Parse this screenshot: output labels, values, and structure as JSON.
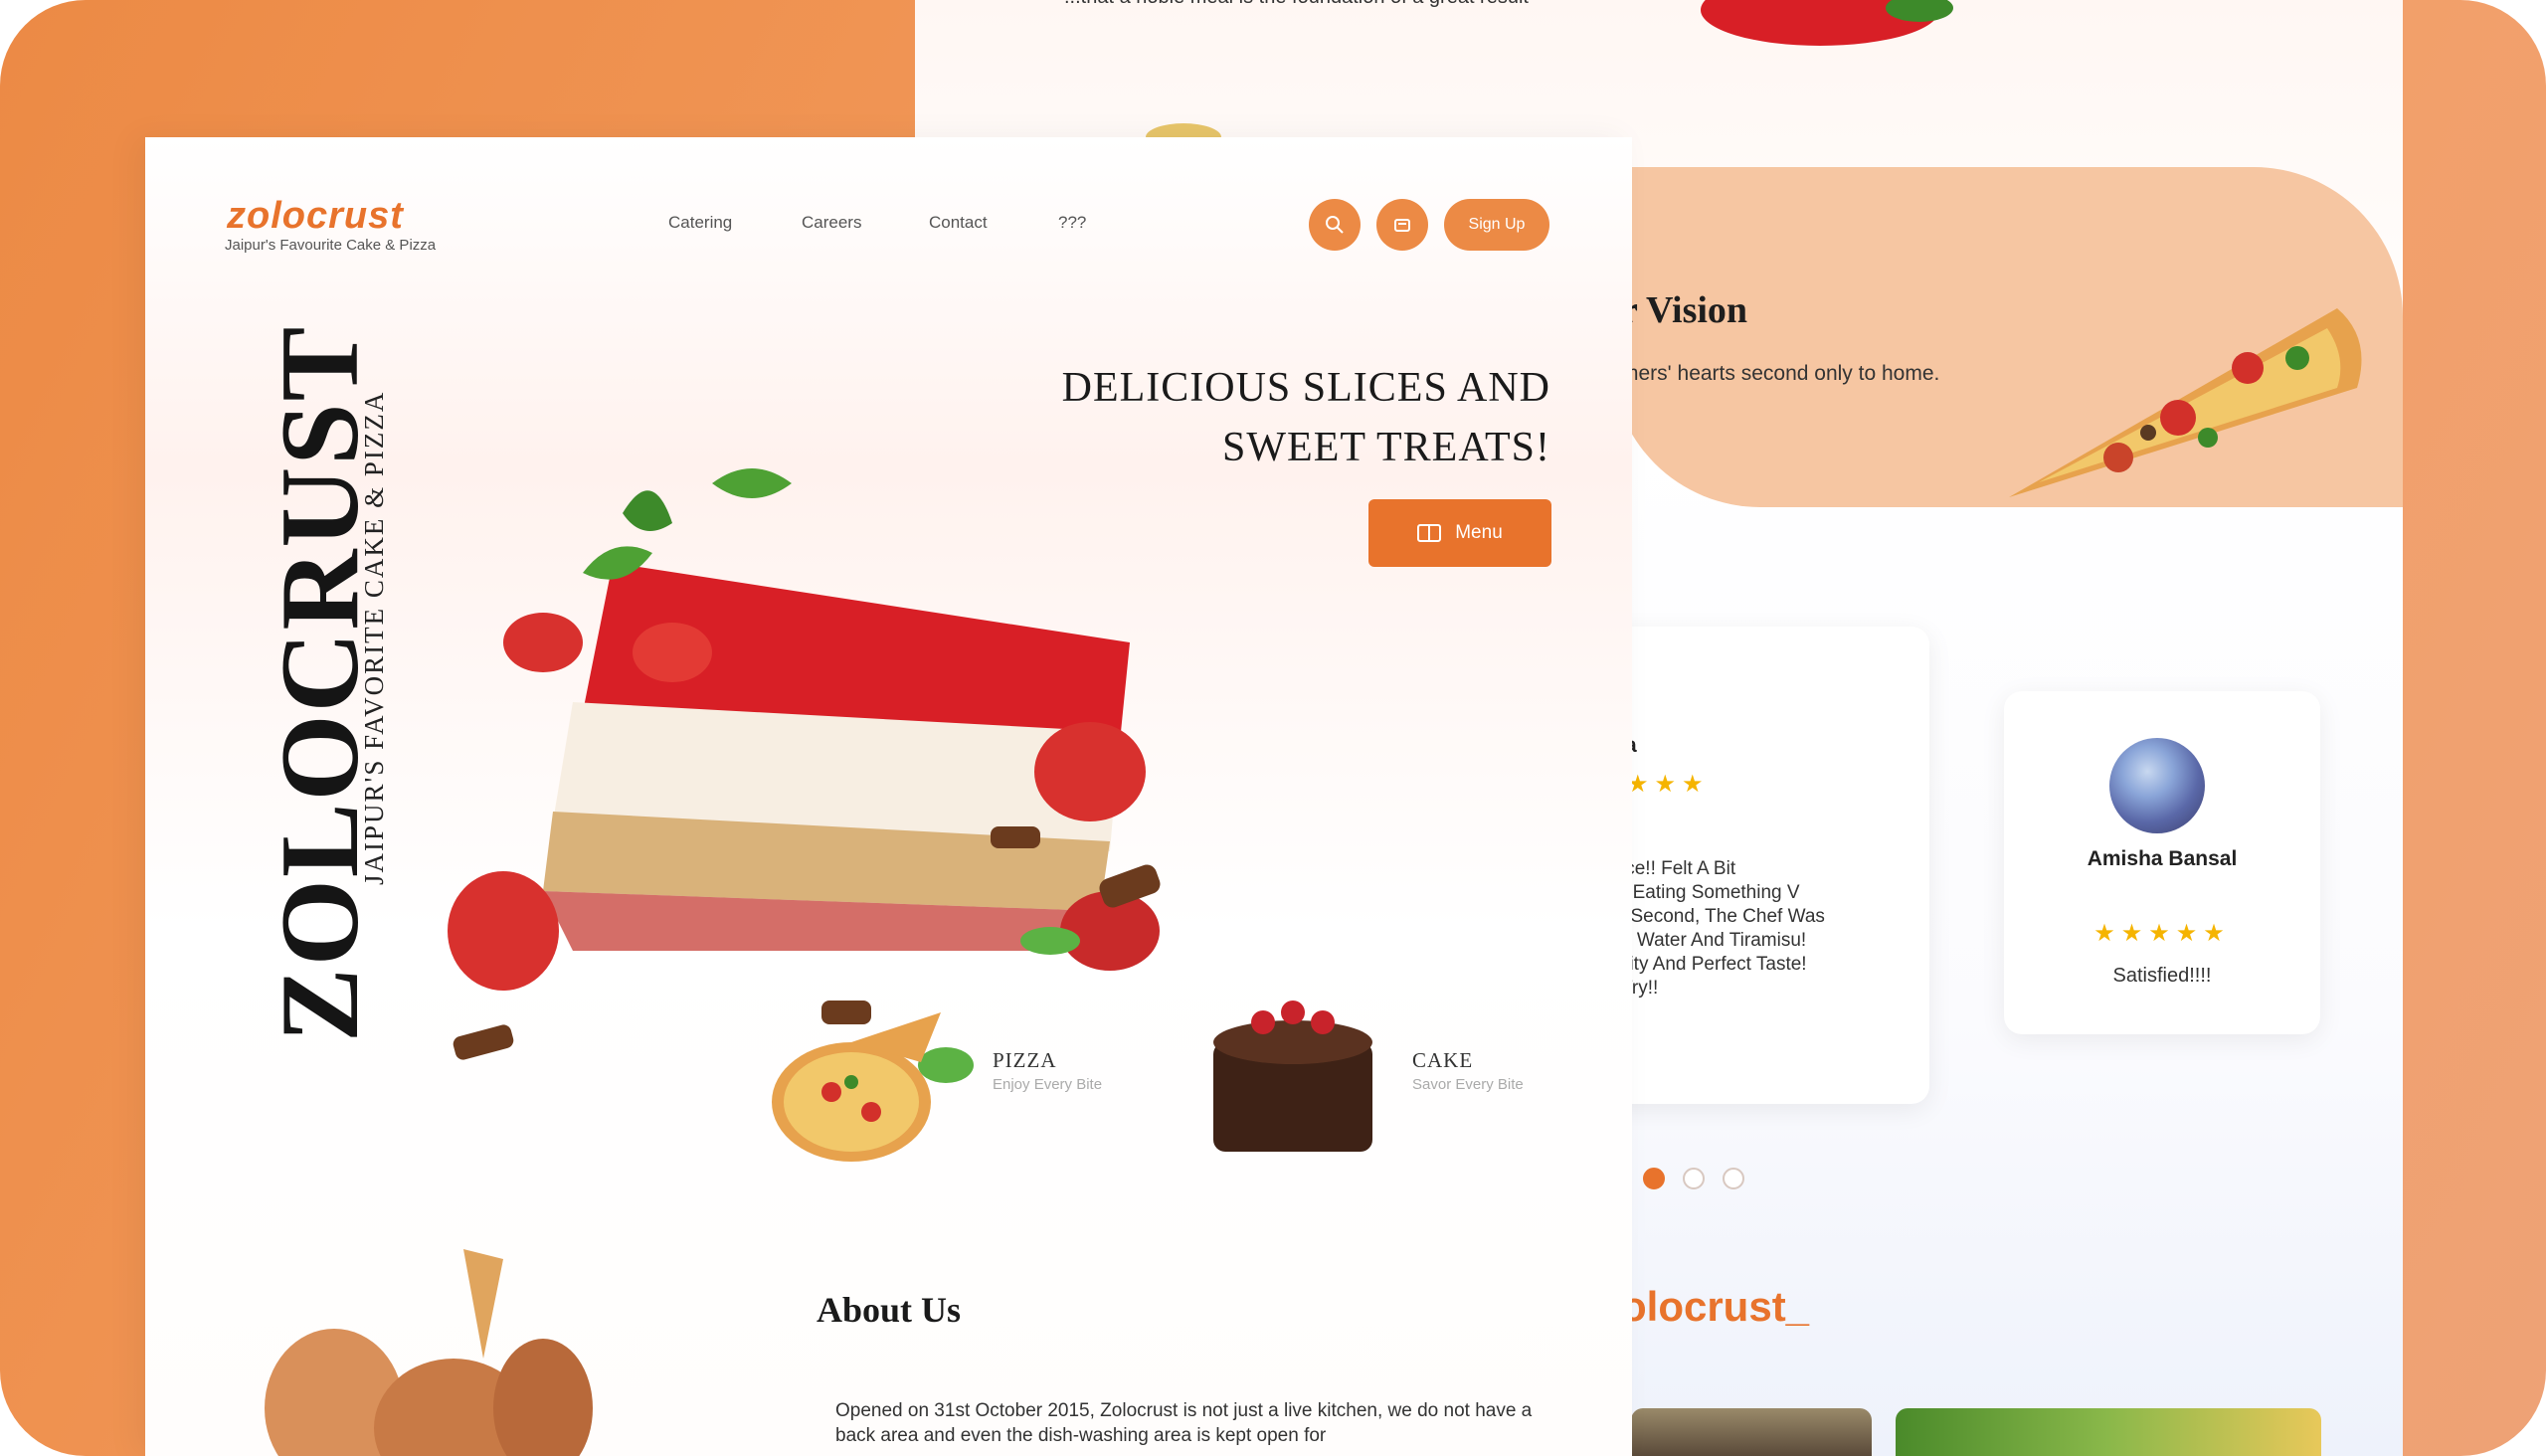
{
  "back_page": {
    "top_quote": "...that a noble meal is the foundation of a great result",
    "vision_title": "r Vision",
    "vision_text": "mers' hearts second only to home.",
    "reviews": [
      {
        "name": "a",
        "rating_text": "★★★",
        "text": "ice!! Felt A Bit\nr Eating Something V\nl Second, The Chef Was\nh Water And Tiramisu!\nility And Perfect Taste!\nTry!!"
      },
      {
        "name": "Amisha Bansal",
        "rating_text": "★★★★★",
        "text": "Satisfied!!!!"
      }
    ],
    "carousel_dots": 3,
    "carousel_active": 0,
    "brand_footer": "olocrust_"
  },
  "front_page": {
    "logo": "zolocrust",
    "logo_tagline": "Jaipur's Favourite Cake & Pizza",
    "nav": [
      "Catering",
      "Careers",
      "Contact",
      "???"
    ],
    "icons": [
      "search-icon",
      "cart-icon"
    ],
    "signup_label": "Sign Up",
    "headline_line1": "DELICIOUS SLICES AND",
    "headline_line2": "SWEET TREATS!",
    "menu_label": "Menu",
    "vertical_brand": "ZOLOCRUST",
    "vertical_subtitle": "JAIPUR'S FAVORITE CAKE & PIZZA",
    "categories": [
      {
        "title": "PIZZA",
        "subtitle": "Enjoy Every Bite"
      },
      {
        "title": "CAKE",
        "subtitle": "Savor Every Bite"
      }
    ],
    "about_title": "About Us",
    "about_text": "Opened on 31st October 2015, Zolocrust is not just a live kitchen, we do not have a back area and even the dish-washing area is kept open for"
  },
  "colors": {
    "accent": "#e8732c",
    "accent_light": "#f6c6a2",
    "frame": "#ec8a45"
  }
}
